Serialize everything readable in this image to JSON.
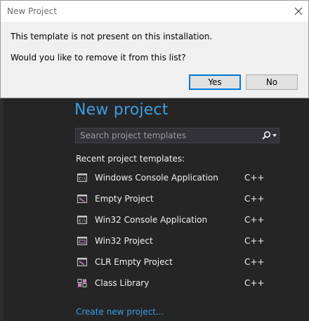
{
  "dialog": {
    "title": "New Project",
    "message_line1": "This template is not present on this installation.",
    "message_line2": "Would you like to remove it from this list?",
    "yes_label": "Yes",
    "no_label": "No"
  },
  "main": {
    "heading": "New project",
    "search_placeholder": "Search project templates",
    "recent_label": "Recent project templates:",
    "templates": [
      {
        "name": "Windows Console Application",
        "lang": "C++",
        "icon": "console-app-icon"
      },
      {
        "name": "Empty Project",
        "lang": "C++",
        "icon": "empty-project-icon"
      },
      {
        "name": "Win32 Console Application",
        "lang": "C++",
        "icon": "console-app-icon"
      },
      {
        "name": "Win32 Project",
        "lang": "C++",
        "icon": "win32-project-icon"
      },
      {
        "name": "CLR Empty Project",
        "lang": "C++",
        "icon": "empty-project-icon"
      },
      {
        "name": "Class Library",
        "lang": "C++",
        "icon": "class-library-icon"
      }
    ],
    "create_link": "Create new project..."
  }
}
